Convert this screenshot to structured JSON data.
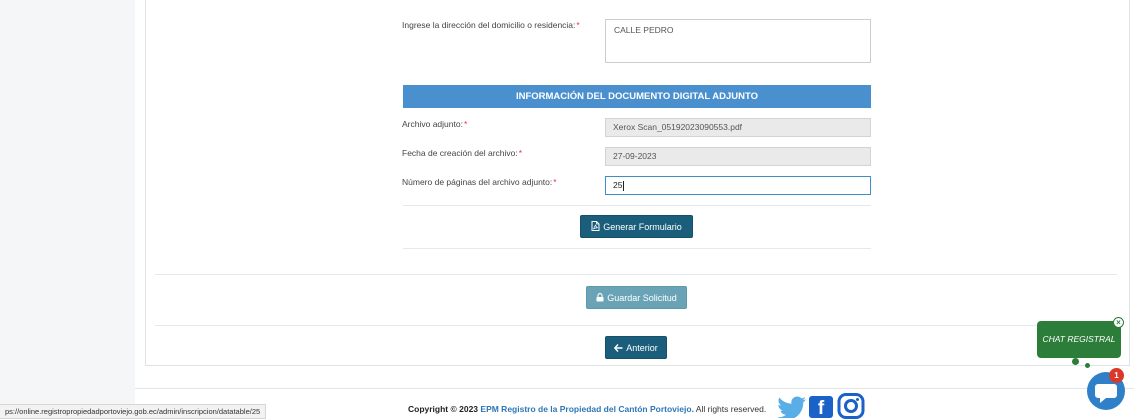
{
  "form": {
    "address_label": "Ingrese la dirección del domicilio o residencia:",
    "address_value": "CALLE PEDRO",
    "required_mark": "*"
  },
  "attachment": {
    "section_title": "INFORMACIÓN DEL DOCUMENTO DIGITAL ADJUNTO",
    "file_label": "Archivo adjunto:",
    "file_value": "Xerox Scan_05192023090553.pdf",
    "date_label": "Fecha de creación del archivo:",
    "date_value": "27-09-2023",
    "pages_label": "Número de páginas del archivo adjunto:",
    "pages_value": "25"
  },
  "buttons": {
    "generate": "Generar Formulario",
    "save": "Guardar Solicitud",
    "previous": "Anterior"
  },
  "footer": {
    "copyright_prefix": "Copyright © 2023",
    "brand": "EPM Registro de la Propiedad del Cantón Portoviejo.",
    "rights": "All rights reserved."
  },
  "status_bar": {
    "url": "ps://online.registropropiedadportoviejo.gob.ec/admin/inscripcion/datatable/25"
  },
  "chat": {
    "label": "CHAT REGISTRAL",
    "close_glyph": "×",
    "badge_count": "1"
  },
  "colors": {
    "section_header": "#4a90cf",
    "primary_button": "#1b5e7b",
    "disabled_button": "#6aa3b6",
    "chat_green": "#2c7d3a",
    "required": "#e0393e"
  },
  "icons": {
    "generate": "pdf-file-icon",
    "save": "lock-icon",
    "previous": "arrow-left-icon",
    "twitter": "twitter-icon",
    "facebook": "facebook-icon",
    "instagram": "instagram-icon",
    "chat": "chat-bubble-icon"
  }
}
